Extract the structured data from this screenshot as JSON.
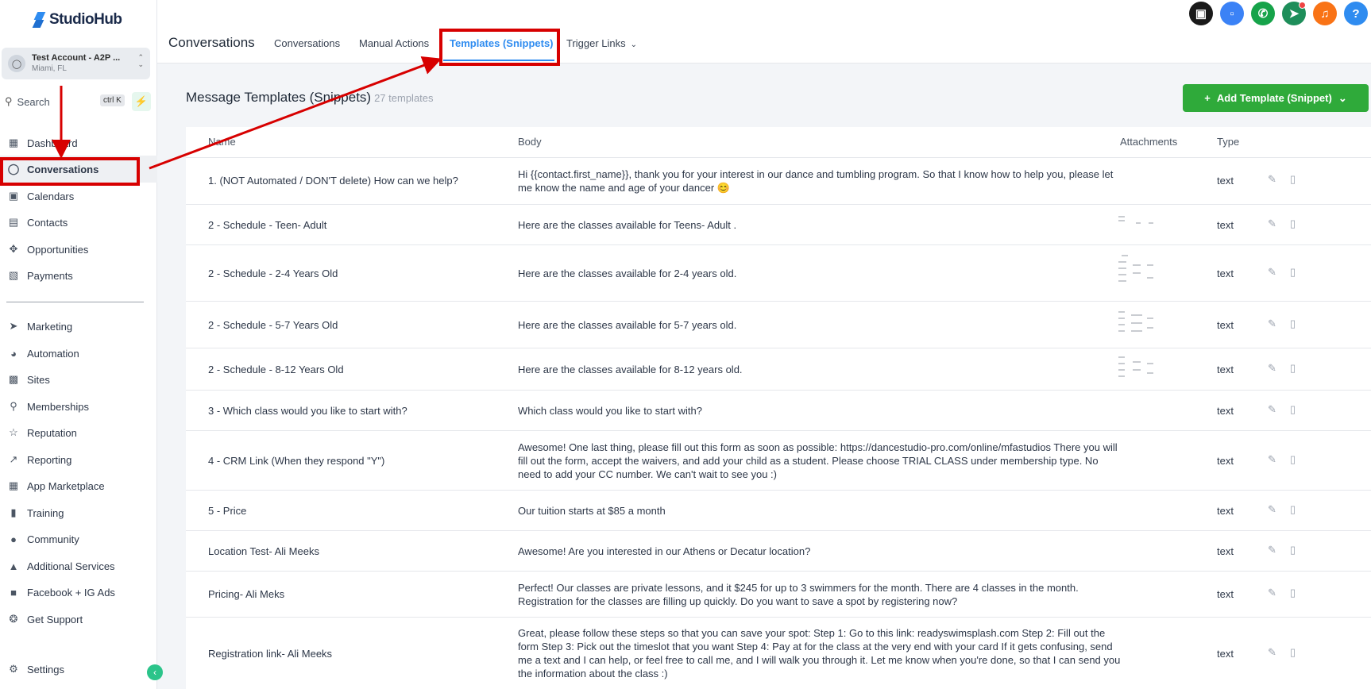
{
  "brand": {
    "name": "StudioHub"
  },
  "account": {
    "name": "Test Account - A2P ...",
    "location": "Miami, FL"
  },
  "search": {
    "label": "Search",
    "shortcut": "ctrl K"
  },
  "nav": [
    {
      "label": "Dashboard",
      "icon": "grid-icon"
    },
    {
      "label": "Conversations",
      "icon": "chat-icon"
    },
    {
      "label": "Calendars",
      "icon": "calendar-icon"
    },
    {
      "label": "Contacts",
      "icon": "contacts-icon"
    },
    {
      "label": "Opportunities",
      "icon": "opportunities-icon"
    },
    {
      "label": "Payments",
      "icon": "payments-icon"
    },
    {
      "label": "Marketing",
      "icon": "send-icon"
    },
    {
      "label": "Automation",
      "icon": "automation-icon"
    },
    {
      "label": "Sites",
      "icon": "sites-icon"
    },
    {
      "label": "Memberships",
      "icon": "badge-icon"
    },
    {
      "label": "Reputation",
      "icon": "star-icon"
    },
    {
      "label": "Reporting",
      "icon": "trend-icon"
    },
    {
      "label": "App Marketplace",
      "icon": "apps-icon"
    },
    {
      "label": "Training",
      "icon": "book-icon"
    },
    {
      "label": "Community",
      "icon": "people-icon"
    },
    {
      "label": "Additional Services",
      "icon": "cart-icon"
    },
    {
      "label": "Facebook + IG Ads",
      "icon": "facebook-icon"
    },
    {
      "label": "Get Support",
      "icon": "lifebuoy-icon"
    }
  ],
  "settings": {
    "label": "Settings"
  },
  "header": {
    "title": "Conversations",
    "tabs": [
      "Conversations",
      "Manual Actions",
      "Templates (Snippets)",
      "Trigger Links"
    ]
  },
  "content": {
    "title": "Message Templates (Snippets)",
    "count": "27 templates",
    "add_button": "Add Template (Snippet)",
    "columns": [
      "Name",
      "Body",
      "Attachments",
      "Type"
    ]
  },
  "templates": [
    {
      "name": "1. (NOT Automated / DON'T delete) How can we help?",
      "body": "Hi {{contact.first_name}}, thank you for your interest in our dance and tumbling program. So that I know how to help you, please let me know the name and age of your dancer 😊",
      "type": "text"
    },
    {
      "name": "2 - Schedule - Teen- Adult",
      "body": "Here are the classes available for Teens- Adult .",
      "type": "text"
    },
    {
      "name": "2 - Schedule - 2-4 Years Old",
      "body": "Here are the classes available for 2-4 years old.",
      "type": "text"
    },
    {
      "name": "2 - Schedule - 5-7 Years Old",
      "body": "Here are the classes available for 5-7 years old.",
      "type": "text"
    },
    {
      "name": "2 - Schedule - 8-12 Years Old",
      "body": "Here are the classes available for 8-12 years old.",
      "type": "text"
    },
    {
      "name": "3 - Which class would you like to start with?",
      "body": "Which class would you like to start with?",
      "type": "text"
    },
    {
      "name": "4 - CRM Link (When they respond \"Y\")",
      "body": "Awesome! One last thing, please fill out this form as soon as possible: https://dancestudio-pro.com/online/mfastudios There you will fill out the form, accept the waivers, and add your child as a student. Please choose TRIAL CLASS under membership type. No need to add your CC number. We can't wait to see you :)",
      "type": "text"
    },
    {
      "name": "5 - Price",
      "body": "Our tuition starts at $85 a month",
      "type": "text"
    },
    {
      "name": "Location Test- Ali Meeks",
      "body": "Awesome! Are you interested in our Athens or Decatur location?",
      "type": "text"
    },
    {
      "name": "Pricing- Ali Meks",
      "body": "Perfect! Our classes are private lessons, and it $245 for up to 3 swimmers for the month. There are 4 classes in the month. Registration for the classes are filling up quickly. Do you want to save a spot by registering now?",
      "type": "text"
    },
    {
      "name": "Registration link- Ali Meeks",
      "body": "Great, please follow these steps so that you can save your spot: Step 1: Go to this link: readyswimsplash.com Step 2: Fill out the form Step 3: Pick out the timeslot that you want Step 4: Pay at for the class at the very end with your card If it gets confusing, send me a text and I can help, or feel free to call me, and I will walk you through it. Let me know when you're done, so that I can send you the information about the class :)",
      "type": "text"
    }
  ],
  "colors": {
    "accent": "#2f8cf0",
    "primary_button": "#2faa3a",
    "annotation": "#d70000"
  }
}
